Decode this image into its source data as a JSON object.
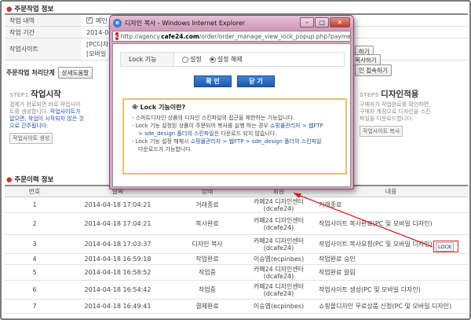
{
  "order_info": {
    "title": "주문작업 정보",
    "rows": [
      {
        "label": "작업 내역",
        "value": "메인",
        "checked": true
      },
      {
        "label": "작업 기간",
        "value": "2014-04"
      },
      {
        "label": "작업사이트",
        "value_line1": "[PC디자",
        "value_line2": "[모바일"
      }
    ],
    "right_btn_1": "하기",
    "right_btn_2": "사이트 복사하기",
    "right_btn_3": "인 접속하기"
  },
  "stage": {
    "title": "주문작업 처리단계",
    "detail_button": "상세도움말"
  },
  "steps": [
    {
      "num": "STEP1",
      "title": "작업시작",
      "desc1": "결제가 완료되면 바로 작업사이",
      "desc2": "트를 생성합니다.",
      "desc3_hl": "작업사이트가",
      "desc4_hl": "없으면, 작업이 시작되지 않은 것",
      "desc5_hl": "으로 간주됩니다.",
      "button": "작업사이트 생성"
    },
    {
      "num": "STEP5",
      "title": "디자인적용",
      "desc1": "구매자가 작업완료를 확인하면,",
      "desc2": "구매자 계정으로 디자인을 스킨",
      "desc3": "파일을 다운로드합니다.",
      "button": "작업사이트 복사"
    }
  ],
  "history": {
    "title": "주문이력 정보",
    "headers": {
      "no": "번호",
      "date": "날짜",
      "state": "상태",
      "member": "회원",
      "content": "내용"
    },
    "rows": [
      {
        "no": "1",
        "date": "2014-04-18 17:04:21",
        "state": "거래종료",
        "member1": "카페24 디자인센터",
        "member2": "(dcafe24)",
        "content": "거래종료"
      },
      {
        "no": "2",
        "date": "2014-04-18 17:04:21",
        "state": "복사완료",
        "member1": "카페24 디자인센터",
        "member2": "(dcafe24)",
        "content": "작업사이트 복사완료(PC 및 모바일 디자인)"
      },
      {
        "no": "3",
        "date": "2014-04-18 17:03:37",
        "state": "디자인 복사",
        "member1": "카페24 디자인센터",
        "member2": "(dcafe24)",
        "content": "작업사이트 복사요청(PC 및 모바일 디자인)"
      },
      {
        "no": "4",
        "date": "2014-04-18 16:59:18",
        "state": "작업완료",
        "member1": "이승엽(ecpinbes)",
        "member2": "",
        "content": "작업완료 승인"
      },
      {
        "no": "5",
        "date": "2014-04-18 16:58:52",
        "state": "작업중",
        "member1": "카페24 디자인센터",
        "member2": "(dcafe24)",
        "content": "작업완료 알림"
      },
      {
        "no": "6",
        "date": "2014-04-18 16:54:42",
        "state": "작업중",
        "member1": "카페24 디자인센터",
        "member2": "(dcafe24)",
        "content": "작업사이트 생성(PC 및 모바일 디자인)"
      },
      {
        "no": "7",
        "date": "2014-04-18 16:49:41",
        "state": "결제완료",
        "member1": "이승엽(ecpinbes)",
        "member2": "",
        "content": "쇼핑몰디자인 무료상품 신청(PC 및 모바일 디자인)"
      }
    ],
    "lock_button": "LOCK"
  },
  "popup": {
    "window_title": "디자인 복사 - Windows Internet Explorer",
    "url_prefix": "http://agency.",
    "url_domain": "cafe24.com",
    "url_suffix": "/order/order_manage_view_lock_popup.php?paymentListIc",
    "lock_label": "Lock 기능",
    "option_set": "설정",
    "option_unset": "설정 해제",
    "confirm": "확 인",
    "close": "닫 기",
    "notice_title": "※ Lock 기능이란?",
    "notice": {
      "l1": "- 스마트디자인 상품의 디자인 스킨파일의 접근을 제한하는 기능입니다.",
      "l2a": "- Lock 기능 설정된 상품이 주문되어 복사를 실행 하는 경우 ",
      "l2b": "쇼핑몰관리자 > 웹FTP",
      "l3a": "> sde_design 폴더의 스킨파일",
      "l3b": "은 다운로드 되지 않습니다.",
      "l4a": "- Lock 기능 설정 해제시 ",
      "l4b": "쇼핑몰관리자 > 웹FTP > sde_design 폴더의 스킨파일",
      "l5": "다운로드가 가능합니다."
    }
  },
  "colors": {
    "accent": "#1c58b0",
    "highlight_red": "#d42020",
    "popup_frame": "#d7a7c3"
  }
}
